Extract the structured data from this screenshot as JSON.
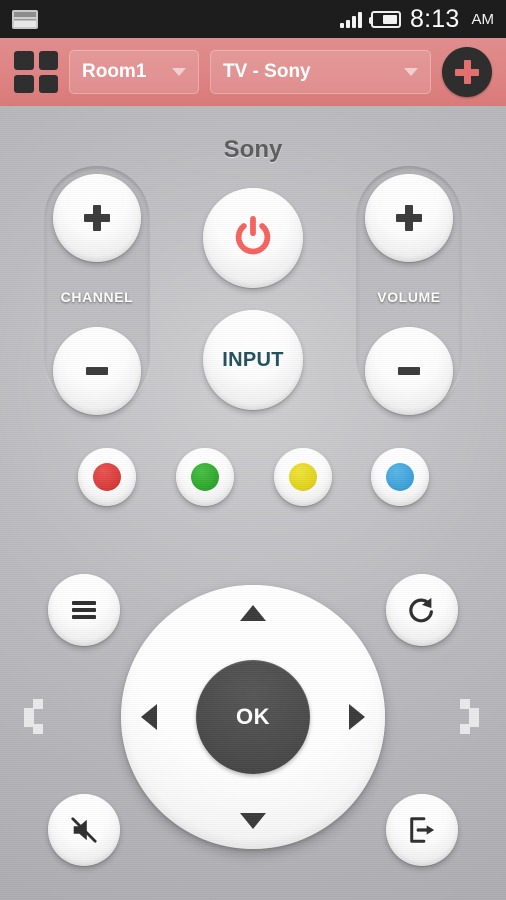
{
  "statusbar": {
    "notification_icon": "screenshot-icon",
    "signal_icon": "signal-bars-icon",
    "battery_icon": "battery-icon",
    "time": "8:13",
    "ampm": "AM"
  },
  "header": {
    "grid_icon": "grid-apps-icon",
    "room_dropdown": {
      "value": "Room1",
      "caret": "chevron-down-icon"
    },
    "device_dropdown": {
      "value": "TV - Sony",
      "caret": "chevron-down-icon"
    },
    "add_button": {
      "label": "+",
      "icon": "plus-icon"
    },
    "background_color": "#de8383",
    "accent_color": "#e2706f"
  },
  "remote": {
    "device_title": "Sony",
    "channel": {
      "label": "CHANNEL",
      "up_label": "+",
      "down_label": "-"
    },
    "volume": {
      "label": "VOLUME",
      "up_label": "+",
      "down_label": "-"
    },
    "power": {
      "icon": "power-icon",
      "color": "#f7625f"
    },
    "input": {
      "label": "INPUT",
      "color": "#22505e"
    },
    "color_buttons": [
      {
        "name": "red-button",
        "color": "#d83836"
      },
      {
        "name": "green-button",
        "color": "#2aa52a"
      },
      {
        "name": "yellow-button",
        "color": "#e0d11a"
      },
      {
        "name": "blue-button",
        "color": "#3a9fd8"
      }
    ],
    "menu_button": {
      "icon": "hamburger-menu-icon"
    },
    "return_button": {
      "icon": "refresh-return-icon"
    },
    "mute_button": {
      "icon": "mute-speaker-icon"
    },
    "exit_button": {
      "icon": "exit-icon"
    },
    "dpad": {
      "up": "arrow-up-icon",
      "down": "arrow-down-icon",
      "left": "arrow-left-icon",
      "right": "arrow-right-icon",
      "ok_label": "OK"
    },
    "page_prev_icon": "chevron-left-icon",
    "page_next_icon": "chevron-right-icon"
  }
}
